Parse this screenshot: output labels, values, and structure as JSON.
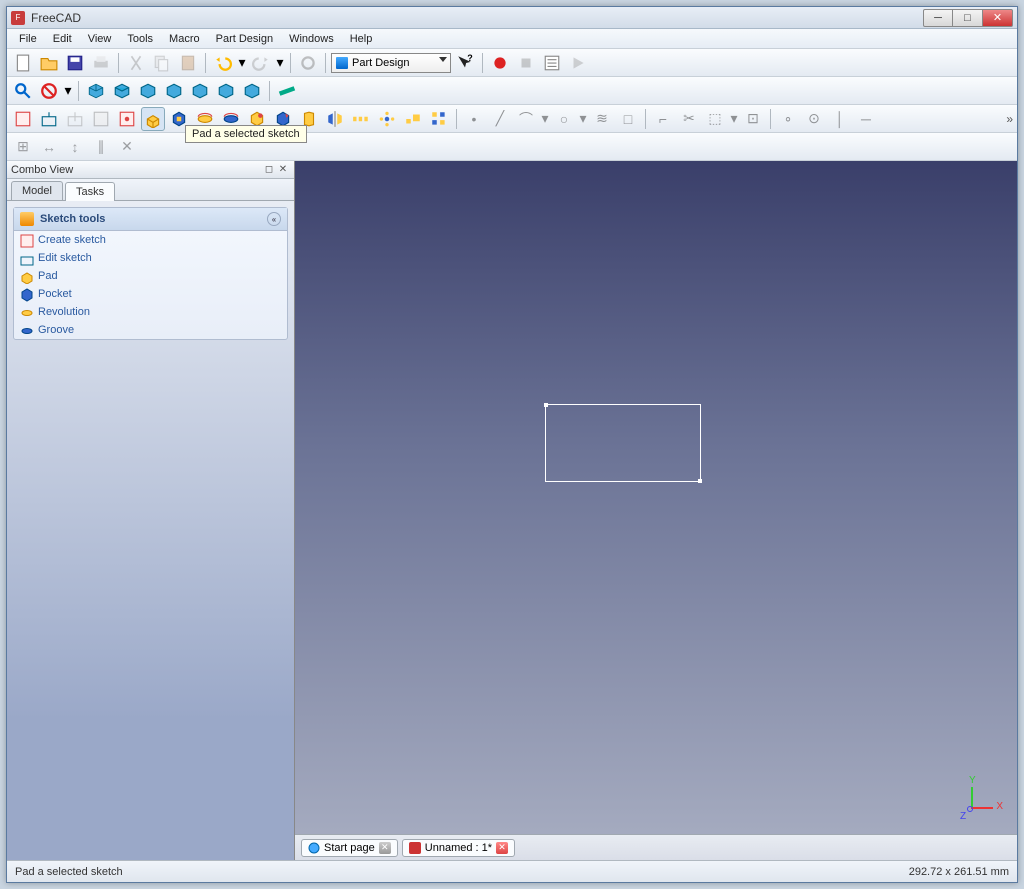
{
  "window": {
    "title": "FreeCAD"
  },
  "menu": [
    "File",
    "Edit",
    "View",
    "Tools",
    "Macro",
    "Part Design",
    "Windows",
    "Help"
  ],
  "workbench_selector": {
    "value": "Part Design"
  },
  "tooltip": "Pad a selected sketch",
  "combo_view": {
    "title": "Combo View",
    "tabs": {
      "model": "Model",
      "tasks": "Tasks"
    },
    "task_group": "Sketch tools",
    "tasks_list": [
      "Create sketch",
      "Edit sketch",
      "Pad",
      "Pocket",
      "Revolution",
      "Groove"
    ]
  },
  "doc_tabs": {
    "start": "Start page",
    "unnamed": "Unnamed : 1*"
  },
  "status": {
    "left": "Pad a selected sketch",
    "right": "292.72 x 261.51 mm"
  },
  "axis": {
    "x": "X",
    "y": "Y",
    "z": "Z"
  },
  "overflow": "»"
}
